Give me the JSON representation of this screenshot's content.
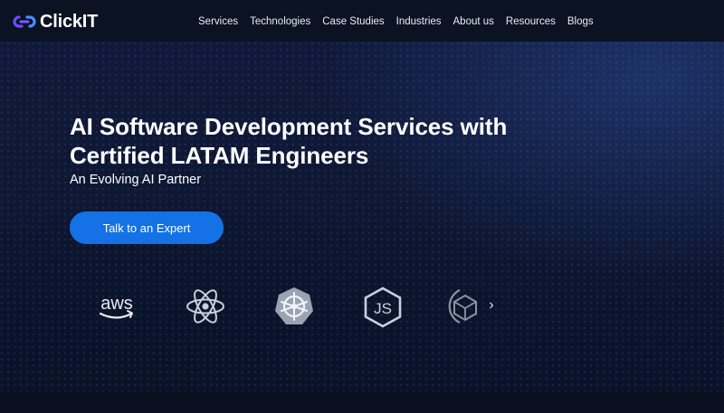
{
  "brand": {
    "name": "ClickIT",
    "accent": "#6c4cff"
  },
  "nav": {
    "items": [
      {
        "label": "Services"
      },
      {
        "label": "Technologies"
      },
      {
        "label": "Case Studies"
      },
      {
        "label": "Industries"
      },
      {
        "label": "About us"
      },
      {
        "label": "Resources"
      },
      {
        "label": "Blogs"
      }
    ]
  },
  "hero": {
    "title_line1": "AI Software Development Services with",
    "title_line2": "Certified LATAM Engineers",
    "subtitle": "An Evolving AI Partner",
    "cta_label": "Talk to an Expert",
    "cta_color": "#1472e6"
  },
  "tech_logos": {
    "items": [
      {
        "icon": "aws-icon",
        "text": "aws"
      },
      {
        "icon": "react-icon"
      },
      {
        "icon": "kubernetes-icon"
      },
      {
        "icon": "nodejs-icon",
        "text": "JS"
      },
      {
        "icon": "cube-icon"
      }
    ],
    "next_icon": "chevron-right-icon",
    "next_glyph": "›"
  }
}
